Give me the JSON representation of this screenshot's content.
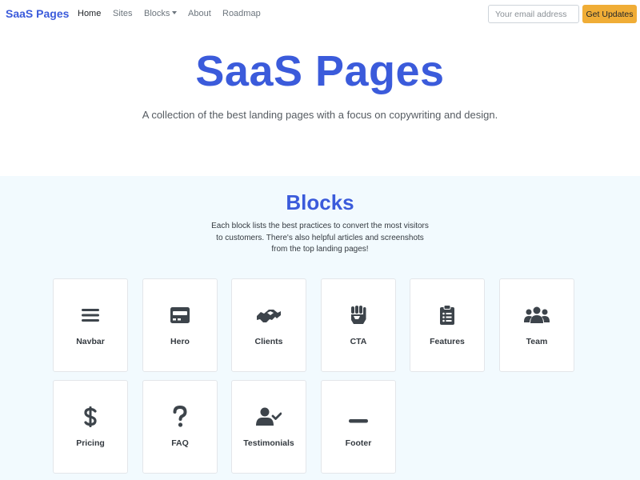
{
  "nav": {
    "brand": "SaaS Pages",
    "links": [
      {
        "label": "Home"
      },
      {
        "label": "Sites"
      },
      {
        "label": "Blocks"
      },
      {
        "label": "About"
      },
      {
        "label": "Roadmap"
      }
    ],
    "email_placeholder": "Your email address",
    "email_value": "",
    "button_label": "Get Updates"
  },
  "hero": {
    "title": "SaaS Pages",
    "subtitle": "A collection of the best landing pages with a focus on copywriting and design."
  },
  "blocks": {
    "title": "Blocks",
    "description": "Each block lists the best practices to convert the most visitors to customers. There's also helpful articles and screenshots from the top landing pages!",
    "items": [
      {
        "label": "Navbar",
        "icon": "bars-icon"
      },
      {
        "label": "Hero",
        "icon": "credit-card-icon"
      },
      {
        "label": "Clients",
        "icon": "handshake-icon"
      },
      {
        "label": "CTA",
        "icon": "fist-icon"
      },
      {
        "label": "Features",
        "icon": "clipboard-list-icon"
      },
      {
        "label": "Team",
        "icon": "users-icon"
      },
      {
        "label": "Pricing",
        "icon": "dollar-icon"
      },
      {
        "label": "FAQ",
        "icon": "question-icon"
      },
      {
        "label": "Testimonials",
        "icon": "user-check-icon"
      },
      {
        "label": "Footer",
        "icon": "minus-icon"
      }
    ]
  },
  "colors": {
    "brand": "#3b5bdb",
    "accent_button": "#f0ad36",
    "section_bg": "#f2fafe",
    "icon": "#3d444b"
  }
}
